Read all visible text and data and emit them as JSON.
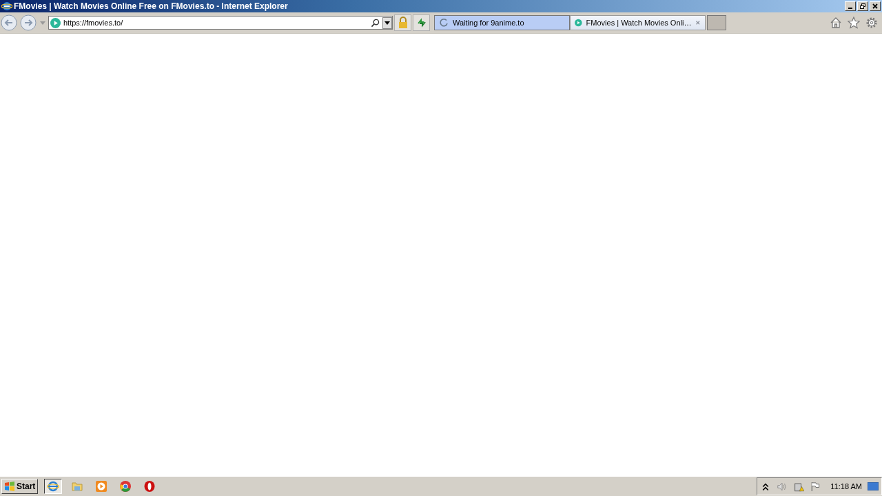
{
  "window": {
    "title": "FMovies | Watch Movies Online Free on FMovies.to - Internet Explorer"
  },
  "address_bar": {
    "value": "https://fmovies.to/"
  },
  "tabs": [
    {
      "label": "Waiting for 9anime.to",
      "kind": "loading",
      "selected": false
    },
    {
      "label": "FMovies | Watch Movies Onli…",
      "kind": "site",
      "selected": true
    }
  ],
  "taskbar": {
    "start": "Start",
    "apps": [
      {
        "kind": "ie",
        "selected": true
      },
      {
        "kind": "folder",
        "selected": false
      },
      {
        "kind": "media",
        "selected": false
      },
      {
        "kind": "chrome",
        "selected": false
      },
      {
        "kind": "opera",
        "selected": false
      }
    ],
    "clock": "11:18 AM"
  }
}
